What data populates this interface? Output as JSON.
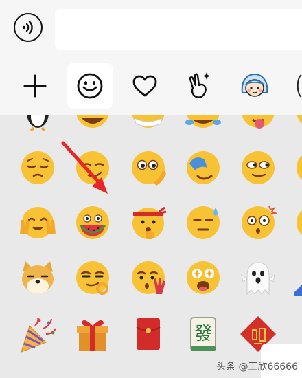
{
  "input": {
    "value": ""
  },
  "tabs": [
    {
      "id": "add",
      "icon": "plus-icon",
      "active": false
    },
    {
      "id": "emoji",
      "icon": "smiley-icon",
      "active": true
    },
    {
      "id": "favorites",
      "icon": "heart-icon",
      "active": false
    },
    {
      "id": "stickers",
      "icon": "peace-hand-icon",
      "active": false
    },
    {
      "id": "memoji",
      "icon": "girl-face-icon",
      "active": false
    }
  ],
  "emoji_rows": [
    [
      "🐧",
      "😁",
      "😷",
      "😂",
      "😛",
      "😀"
    ],
    [
      "😔",
      "😏",
      "🤔",
      "🤦",
      "😒",
      "😐"
    ],
    [
      "🥳",
      "🍉",
      "😳",
      "😓",
      "😲",
      "😉"
    ],
    [
      "🐕",
      "😏",
      "😘",
      "🤩",
      "👻",
      "📈"
    ],
    [
      "🎉",
      "🎁",
      "🧧",
      "🀅",
      "🧧"
    ]
  ],
  "watermark": "头条 @王欣66666",
  "colors": {
    "accent_arrow": "#e8262a",
    "panel": "#f6f6f6",
    "grid_bg": "#e9e9e9"
  }
}
